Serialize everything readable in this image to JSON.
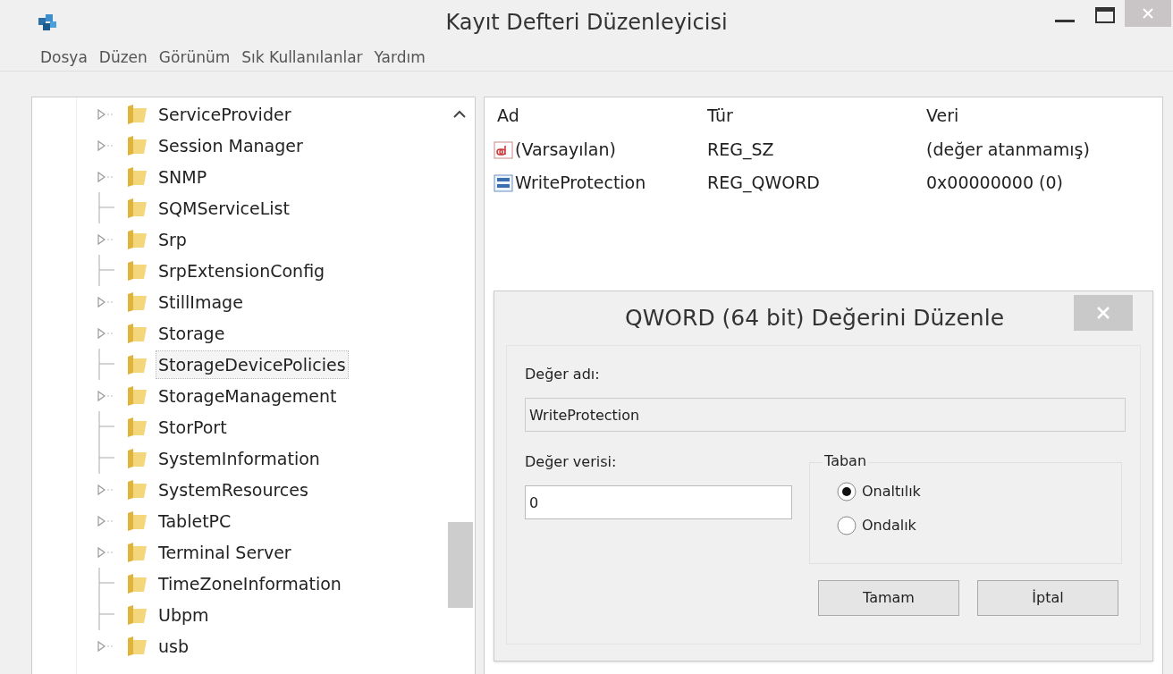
{
  "window": {
    "title": "Kayıt Defteri Düzenleyicisi"
  },
  "menu": [
    "Dosya",
    "Düzen",
    "Görünüm",
    "Sık Kullanılanlar",
    "Yardım"
  ],
  "tree": {
    "items": [
      {
        "label": "ServiceProvider",
        "expandable": true,
        "selected": false
      },
      {
        "label": "Session Manager",
        "expandable": true,
        "selected": false
      },
      {
        "label": "SNMP",
        "expandable": true,
        "selected": false
      },
      {
        "label": "SQMServiceList",
        "expandable": false,
        "selected": false
      },
      {
        "label": "Srp",
        "expandable": true,
        "selected": false
      },
      {
        "label": "SrpExtensionConfig",
        "expandable": false,
        "selected": false
      },
      {
        "label": "StillImage",
        "expandable": true,
        "selected": false
      },
      {
        "label": "Storage",
        "expandable": true,
        "selected": false
      },
      {
        "label": "StorageDevicePolicies",
        "expandable": false,
        "selected": true
      },
      {
        "label": "StorageManagement",
        "expandable": true,
        "selected": false
      },
      {
        "label": "StorPort",
        "expandable": false,
        "selected": false
      },
      {
        "label": "SystemInformation",
        "expandable": false,
        "selected": false
      },
      {
        "label": "SystemResources",
        "expandable": true,
        "selected": false
      },
      {
        "label": "TabletPC",
        "expandable": true,
        "selected": false
      },
      {
        "label": "Terminal Server",
        "expandable": true,
        "selected": false
      },
      {
        "label": "TimeZoneInformation",
        "expandable": false,
        "selected": false
      },
      {
        "label": "Ubpm",
        "expandable": false,
        "selected": false
      },
      {
        "label": "usb",
        "expandable": true,
        "selected": false
      }
    ]
  },
  "values": {
    "columns": [
      "Ad",
      "Tür",
      "Veri"
    ],
    "rows": [
      {
        "kind": "string",
        "name": "(Varsayılan)",
        "type": "REG_SZ",
        "data": "(değer atanmamış)"
      },
      {
        "kind": "binary",
        "name": "WriteProtection",
        "type": "REG_QWORD",
        "data": "0x00000000 (0)"
      }
    ]
  },
  "dialog": {
    "title": "QWORD (64 bit) Değerini Düzenle",
    "name_label": "Değer adı:",
    "name_value": "WriteProtection",
    "data_label": "Değer verisi:",
    "data_value": "0",
    "base": {
      "title": "Taban",
      "options": [
        {
          "label": "Onaltılık",
          "selected": true
        },
        {
          "label": "Ondalık",
          "selected": false
        }
      ]
    },
    "buttons": [
      "Tamam",
      "İptal"
    ]
  }
}
